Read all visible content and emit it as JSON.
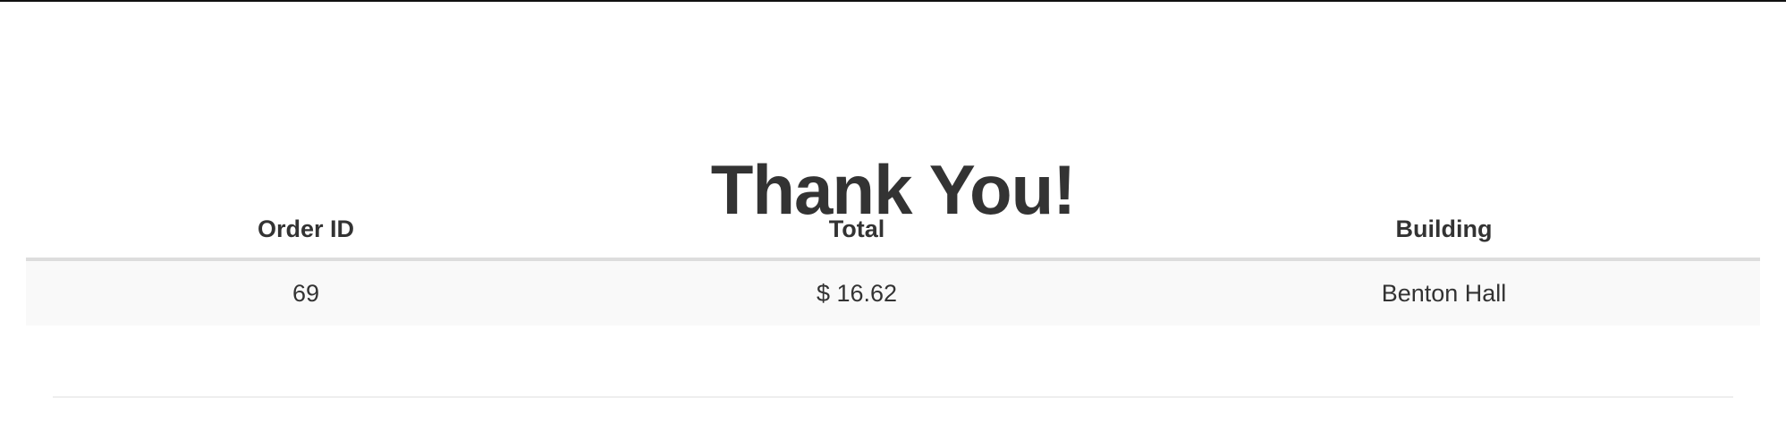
{
  "page": {
    "title": "Thank You!"
  },
  "order_table": {
    "columns": [
      "Order ID",
      "Total",
      "Building"
    ],
    "rows": [
      {
        "order_id": "69",
        "total": "$ 16.62",
        "building": "Benton Hall"
      }
    ]
  },
  "colors": {
    "text": "#333333",
    "row_background": "#f9f9f9",
    "header_rule": "#dddddd",
    "top_border": "#111111"
  }
}
